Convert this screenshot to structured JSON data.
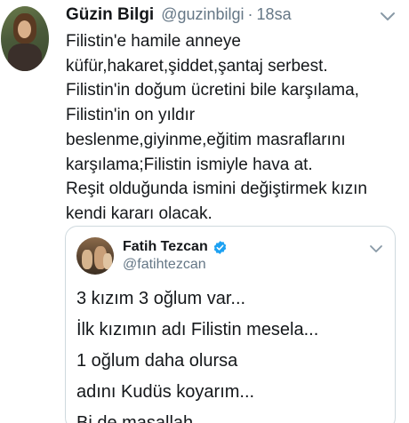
{
  "tweet": {
    "author_name": "Güzin Bilgi",
    "author_handle": "@guzinbilgi",
    "separator": "·",
    "time": "18sa",
    "lines": [
      "Filistin'e hamile anneye",
      "küfür,hakaret,şiddet,şantaj serbest.",
      "Filistin'in doğum ücretini bile karşılama,",
      "Filistin'in on yıldır",
      "beslenme,giyinme,eğitim masraflarını",
      "karşılama;Filistin ismiyle hava at.",
      "Reşit olduğunda ismini değiştirmek kızın",
      "kendi kararı olacak."
    ],
    "icons": {
      "avatar": "user-avatar",
      "menu": "chevron-down-icon"
    }
  },
  "quoted_tweet": {
    "author_name": "Fatih Tezcan",
    "author_handle": "@fatihtezcan",
    "lines": [
      "3 kızım 3 oğlum var...",
      "İlk kızımın adı Filistin mesela...",
      "1 oğlum daha olursa",
      "adını Kudüs koyarım...",
      "Bi de maşallah ...."
    ],
    "icons": {
      "avatar": "user-avatar",
      "verified": "verified-badge-icon",
      "menu": "chevron-down-icon"
    }
  },
  "colors": {
    "text": "#14171a",
    "secondary": "#657786",
    "border": "#cfd9de",
    "verified": "#1da1f2"
  }
}
